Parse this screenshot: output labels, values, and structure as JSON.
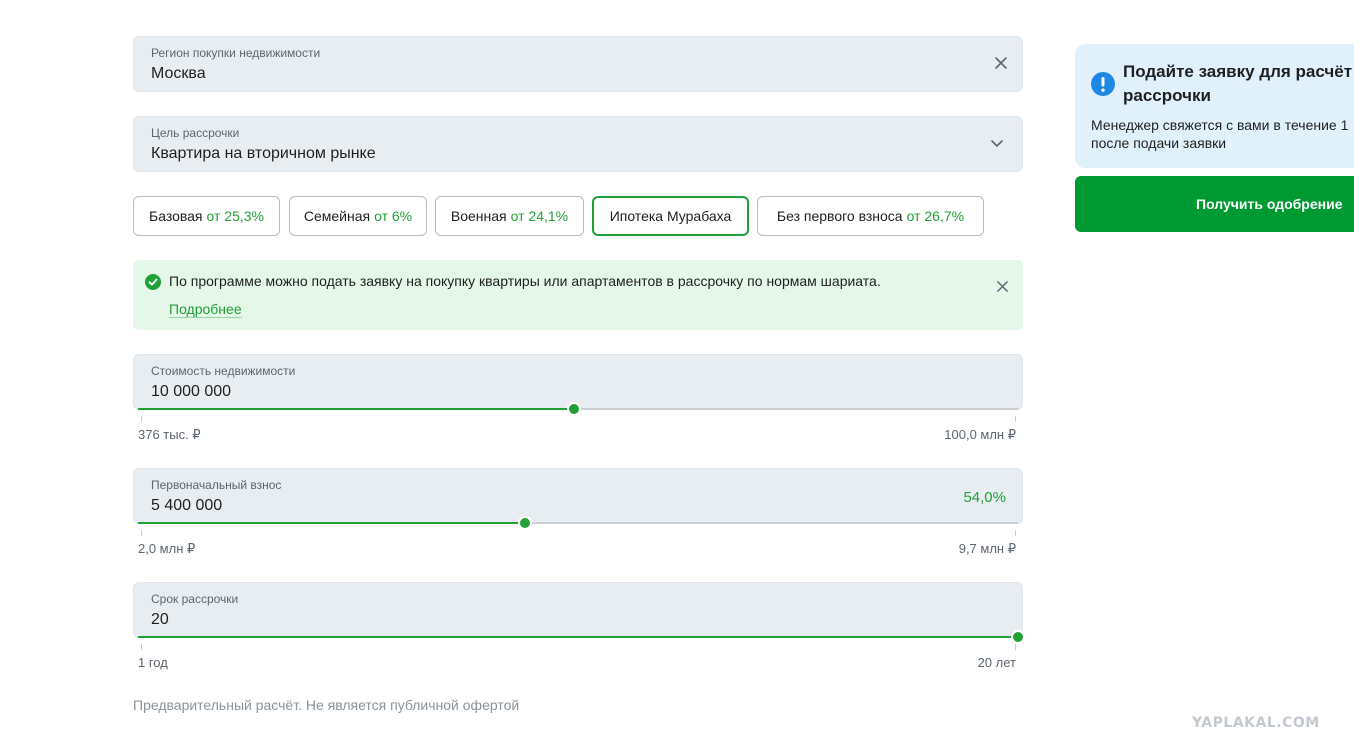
{
  "region": {
    "label": "Регион покупки недвижимости",
    "value": "Москва"
  },
  "purpose": {
    "label": "Цель рассрочки",
    "value": "Квартира на вторичном рынке"
  },
  "programs": [
    {
      "name": "Базовая",
      "rate": "от 25,3%"
    },
    {
      "name": "Семейная",
      "rate": "от 6%"
    },
    {
      "name": "Военная",
      "rate": "от 24,1%"
    },
    {
      "name": "Ипотека Мурабаха",
      "rate": ""
    },
    {
      "name": "Без первого взноса",
      "rate": "от 26,7%"
    }
  ],
  "selected_program": "Ипотека Мурабаха",
  "notice": {
    "text": "По программе можно подать заявку на покупку квартиры или апартаментов в рассрочку по нормам шариата.",
    "link": "Подробнее"
  },
  "price": {
    "label": "Стоимость недвижимости",
    "value": "10 000 000",
    "min": "376 тыс. ₽",
    "max": "100,0 млн ₽",
    "slider_fraction": 0.495
  },
  "down_payment": {
    "label": "Первоначальный взнос",
    "value": "5 400 000",
    "percent": "54,0%",
    "min": "2,0 млн ₽",
    "max": "9,7 млн ₽",
    "slider_fraction": 0.44
  },
  "term": {
    "label": "Срок рассрочки",
    "value": "20",
    "min": "1 год",
    "max": "20 лет",
    "slider_fraction": 1.0
  },
  "disclaimer": "Предварительный расчёт. Не является публичной офертой",
  "side": {
    "title_line1": "Подайте заявку для расчёт",
    "title_line2": "рассрочки",
    "text_line1": "Менеджер свяжется с вами в течение 1",
    "text_line2": "после подачи заявки",
    "button": "Получить одобрение"
  },
  "watermark": "YAPLAKAL.COM",
  "colors": {
    "accent": "#21a038",
    "button": "#009a33",
    "field_bg": "#e8edf1",
    "notice_bg": "#e4f7e8",
    "info_bg": "#e0f1fb",
    "info_icon": "#1e88e5"
  }
}
